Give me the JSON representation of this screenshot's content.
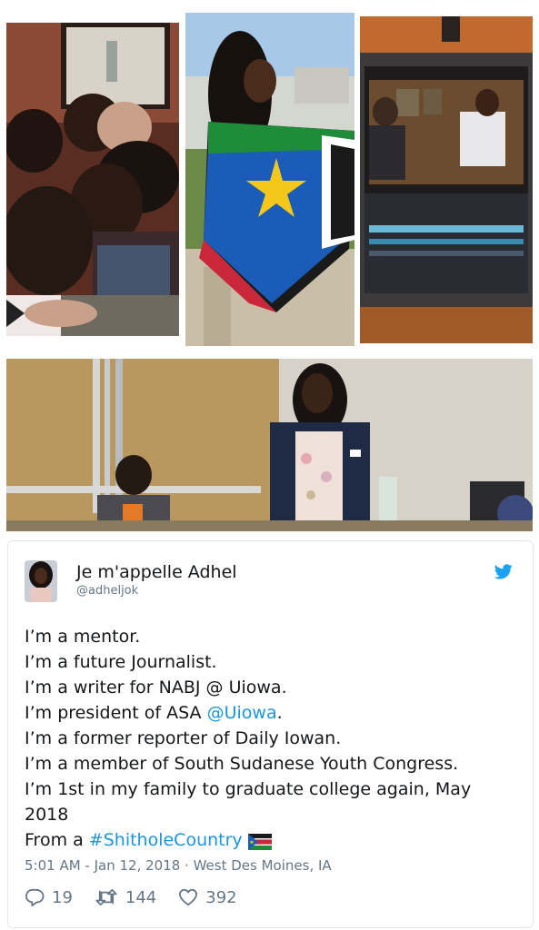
{
  "tweet": {
    "author_name": "Je m'appelle Adhel",
    "handle": "@adheljok",
    "lines": [
      "I’m a mentor.",
      "I’m a future Journalist.",
      "I’m a writer for NABJ @ Uiowa.",
      "I’m president of ASA ",
      "I’m a former reporter of Daily Iowan.",
      "I’m a member of South Sudanese Youth Congress.",
      "I’m 1st in my family to graduate college again, May",
      "2018",
      "From a "
    ],
    "mention_link": "@Uiowa",
    "mention_suffix": ".",
    "hashtag": "#ShitholeCountry",
    "timestamp": "5:01 AM - Jan 12, 2018 · West Des Moines, IA",
    "replies": "19",
    "retweets": "144",
    "likes": "392"
  },
  "icons": {
    "twitter": "twitter-bird-icon",
    "reply": "reply-icon",
    "retweet": "retweet-icon",
    "like": "heart-icon",
    "flag": "south-sudan-flag-emoji"
  },
  "colors": {
    "link": "#1b95e0",
    "secondary_text": "#657786",
    "primary_text": "#14171a",
    "border": "#e1e8ed"
  }
}
